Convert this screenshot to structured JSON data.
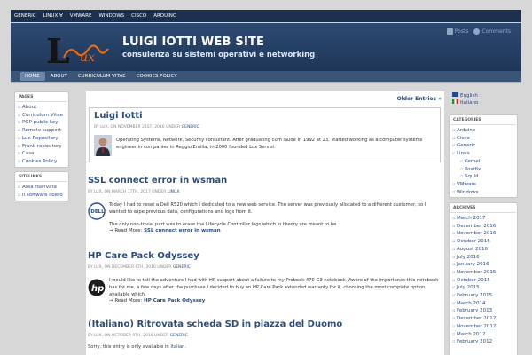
{
  "topnav": [
    "GENERIC",
    "LINUX ∀",
    "VMWARE",
    "WINDOWS",
    "CISCO",
    "ARDUINO"
  ],
  "site": {
    "title": "LUIGI IOTTI WEB SITE",
    "tagline": "consulenza su sistemi operativi e networking",
    "feeds": [
      "Posts",
      "Comments"
    ]
  },
  "menu": [
    "HOME",
    "ABOUT",
    "CURRICULUM VITAE",
    "COOKIES POLICY"
  ],
  "left_sidebar": [
    {
      "title": "PAGES",
      "items": [
        "About",
        "Curriculum Vitae",
        "PGP public key",
        "Remote support",
        "Lux Repository",
        "Frank repository",
        "Casa",
        "Cookies Policy"
      ]
    },
    {
      "title": "SITELINKS",
      "items": [
        "Area riservata",
        "Il software libero"
      ]
    }
  ],
  "right_sidebar": {
    "languages": [
      "English",
      "Italiano"
    ],
    "categories_title": "CATEGORIES",
    "categories": [
      {
        "label": "Arduino",
        "sub": false
      },
      {
        "label": "Cisco",
        "sub": false
      },
      {
        "label": "Generic",
        "sub": false
      },
      {
        "label": "Linux",
        "sub": false
      },
      {
        "label": "Kernel",
        "sub": true
      },
      {
        "label": "Postfix",
        "sub": true
      },
      {
        "label": "Squid",
        "sub": true
      },
      {
        "label": "VMware",
        "sub": false
      },
      {
        "label": "Windows",
        "sub": false
      }
    ],
    "archives_title": "ARCHIVES",
    "archives": [
      "March 2017",
      "December 2016",
      "November 2016",
      "October 2016",
      "August 2016",
      "July 2016",
      "January 2016",
      "November 2015",
      "October 2015",
      "July 2015",
      "February 2015",
      "March 2014",
      "February 2013",
      "December 2012",
      "November 2012",
      "March 2012",
      "February 2012"
    ]
  },
  "main": {
    "older_entries": "Older Entries »",
    "featured": {
      "title": "Luigi Iotti",
      "meta": "BY LUX, ON NOVEMBER 21ST, 2016 UNDER",
      "category": "GENERIC",
      "body": "Operating Systems, Network, Security consultant. After graduating cum laude in 1992 at 23, started working as a computer systems engineer in companies in Reggio Emilia; in 2000 founded Lux Servizi."
    },
    "posts": [
      {
        "title": "SSL connect error in wsman",
        "meta": "BY LUX, ON MARCH 17TH, 2017 UNDER",
        "category": "LINUX",
        "body1": "Today I had to reset a Dell R520 which I dedicated to a new web service. The server was previously allocated to a different customer, so I wanted to wipe previous data, configurations and logs from it.",
        "body2": "The only non-trivial part was to erase the Lifecycle Controller logs which in theory are meant to be",
        "readmore_prefix": "→ Read More:",
        "readmore_link": "SSL connect error in wsman"
      },
      {
        "title": "HP Care Pack Odyssey",
        "meta": "BY LUX, ON DECEMBER 6TH, 2016 UNDER",
        "category": "GENERIC",
        "body1": "I would like to tell the adventure I had with HP support about a failure to my Probook 470 G3 notebook. Aware of the importance this notebook has for me, a few days after the purchase I decided to buy an HP Care Pack extended warranty for it, choosing the most complete option available which",
        "readmore_prefix": "→ Read More:",
        "readmore_link": "HP Care Pack Odyssey"
      },
      {
        "title": "(Italiano) Ritrovata scheda SD in piazza del Duomo",
        "meta": "BY LUX, ON OCTOBER 9TH, 2016 UNDER",
        "category": "GENERIC",
        "body1": "Sorry, this entry is only available in",
        "body_link": "Italian"
      }
    ]
  }
}
